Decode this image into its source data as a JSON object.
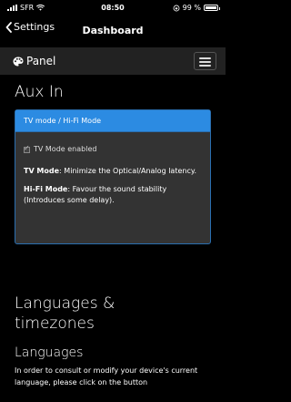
{
  "status": {
    "carrier": "SFR",
    "time": "08:50",
    "battery": "99 %"
  },
  "nav": {
    "back_label": "Settings",
    "title": "Dashboard"
  },
  "panel": {
    "brand": "Panel"
  },
  "aux": {
    "title": "Aux In",
    "card_header": "TV mode / Hi-Fi Mode",
    "checkbox_label": "TV Mode enabled",
    "tv_label": "TV Mode",
    "tv_text": ": Minimize the Optical/Analog latency.",
    "hifi_label": "Hi-Fi Mode",
    "hifi_text": ": Favour the sound stability (Introduces some delay)."
  },
  "languages_section": {
    "title": "Languages & timezones",
    "sub_title": "Languages",
    "paragraph": "In order to consult or modify your device's current language, please click on the button"
  }
}
